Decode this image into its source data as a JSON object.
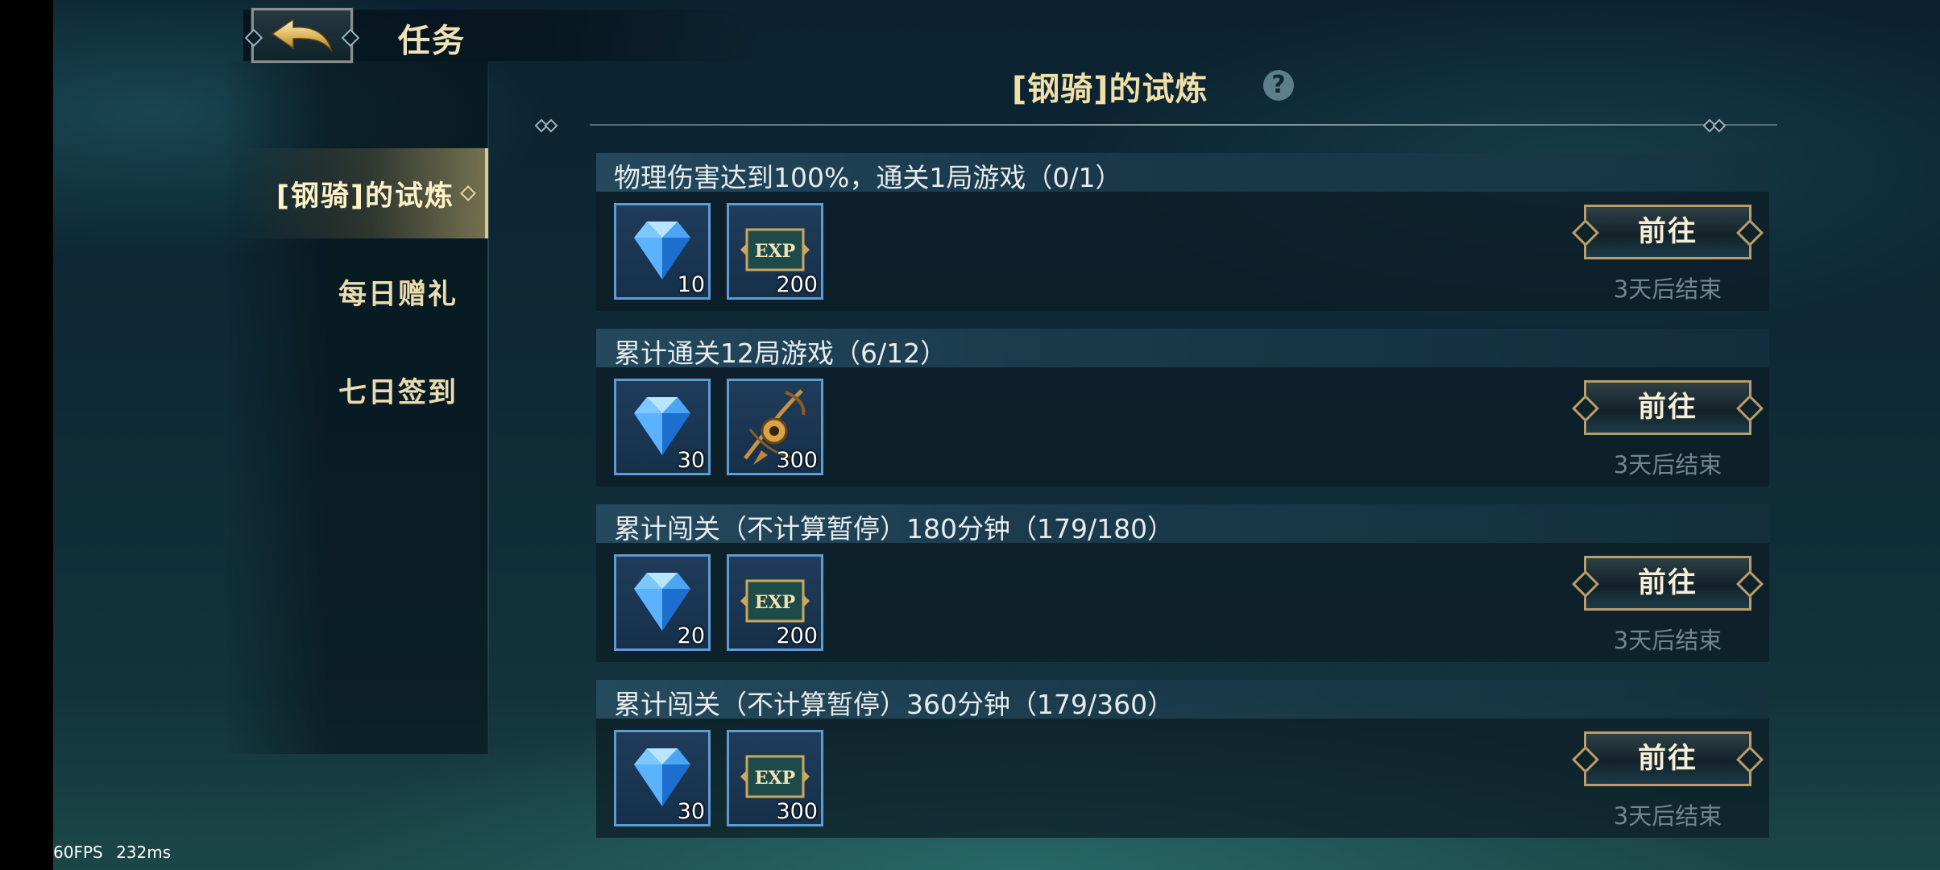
{
  "header": {
    "title": "任务"
  },
  "tabs": [
    {
      "label": "[钢骑]的试炼",
      "active": true
    },
    {
      "label": "每日赠礼",
      "active": false
    },
    {
      "label": "七日签到",
      "active": false
    }
  ],
  "section": {
    "title": "[钢骑]的试炼"
  },
  "tasks": [
    {
      "description": "物理伤害达到100%，通关1局游戏（0/1）",
      "rewards": [
        {
          "icon": "blue-diamond-icon",
          "count": "10"
        },
        {
          "icon": "exp-card-icon",
          "count": "200"
        }
      ],
      "button_label": "前往",
      "end_label": "3天后结束"
    },
    {
      "description": "累计通关12局游戏（6/12）",
      "rewards": [
        {
          "icon": "blue-diamond-icon",
          "count": "30"
        },
        {
          "icon": "golden-crossbow-icon",
          "count": "300"
        }
      ],
      "button_label": "前往",
      "end_label": "3天后结束"
    },
    {
      "description": "累计闯关（不计算暂停）180分钟（179/180）",
      "rewards": [
        {
          "icon": "blue-diamond-icon",
          "count": "20"
        },
        {
          "icon": "exp-card-icon",
          "count": "200"
        }
      ],
      "button_label": "前往",
      "end_label": "3天后结束"
    },
    {
      "description": "累计闯关（不计算暂停）360分钟（179/360）",
      "rewards": [
        {
          "icon": "blue-diamond-icon",
          "count": "30"
        },
        {
          "icon": "exp-card-icon",
          "count": "300"
        }
      ],
      "button_label": "前往",
      "end_label": "3天后结束"
    }
  ],
  "overlay": {
    "fps": "60FPS",
    "latency": "232ms"
  },
  "colors": {
    "accent_gold": "#f1dfa8",
    "reward_border": "#5e9bd3",
    "button_border": "#b99d6a",
    "muted_text": "#6f8791"
  }
}
